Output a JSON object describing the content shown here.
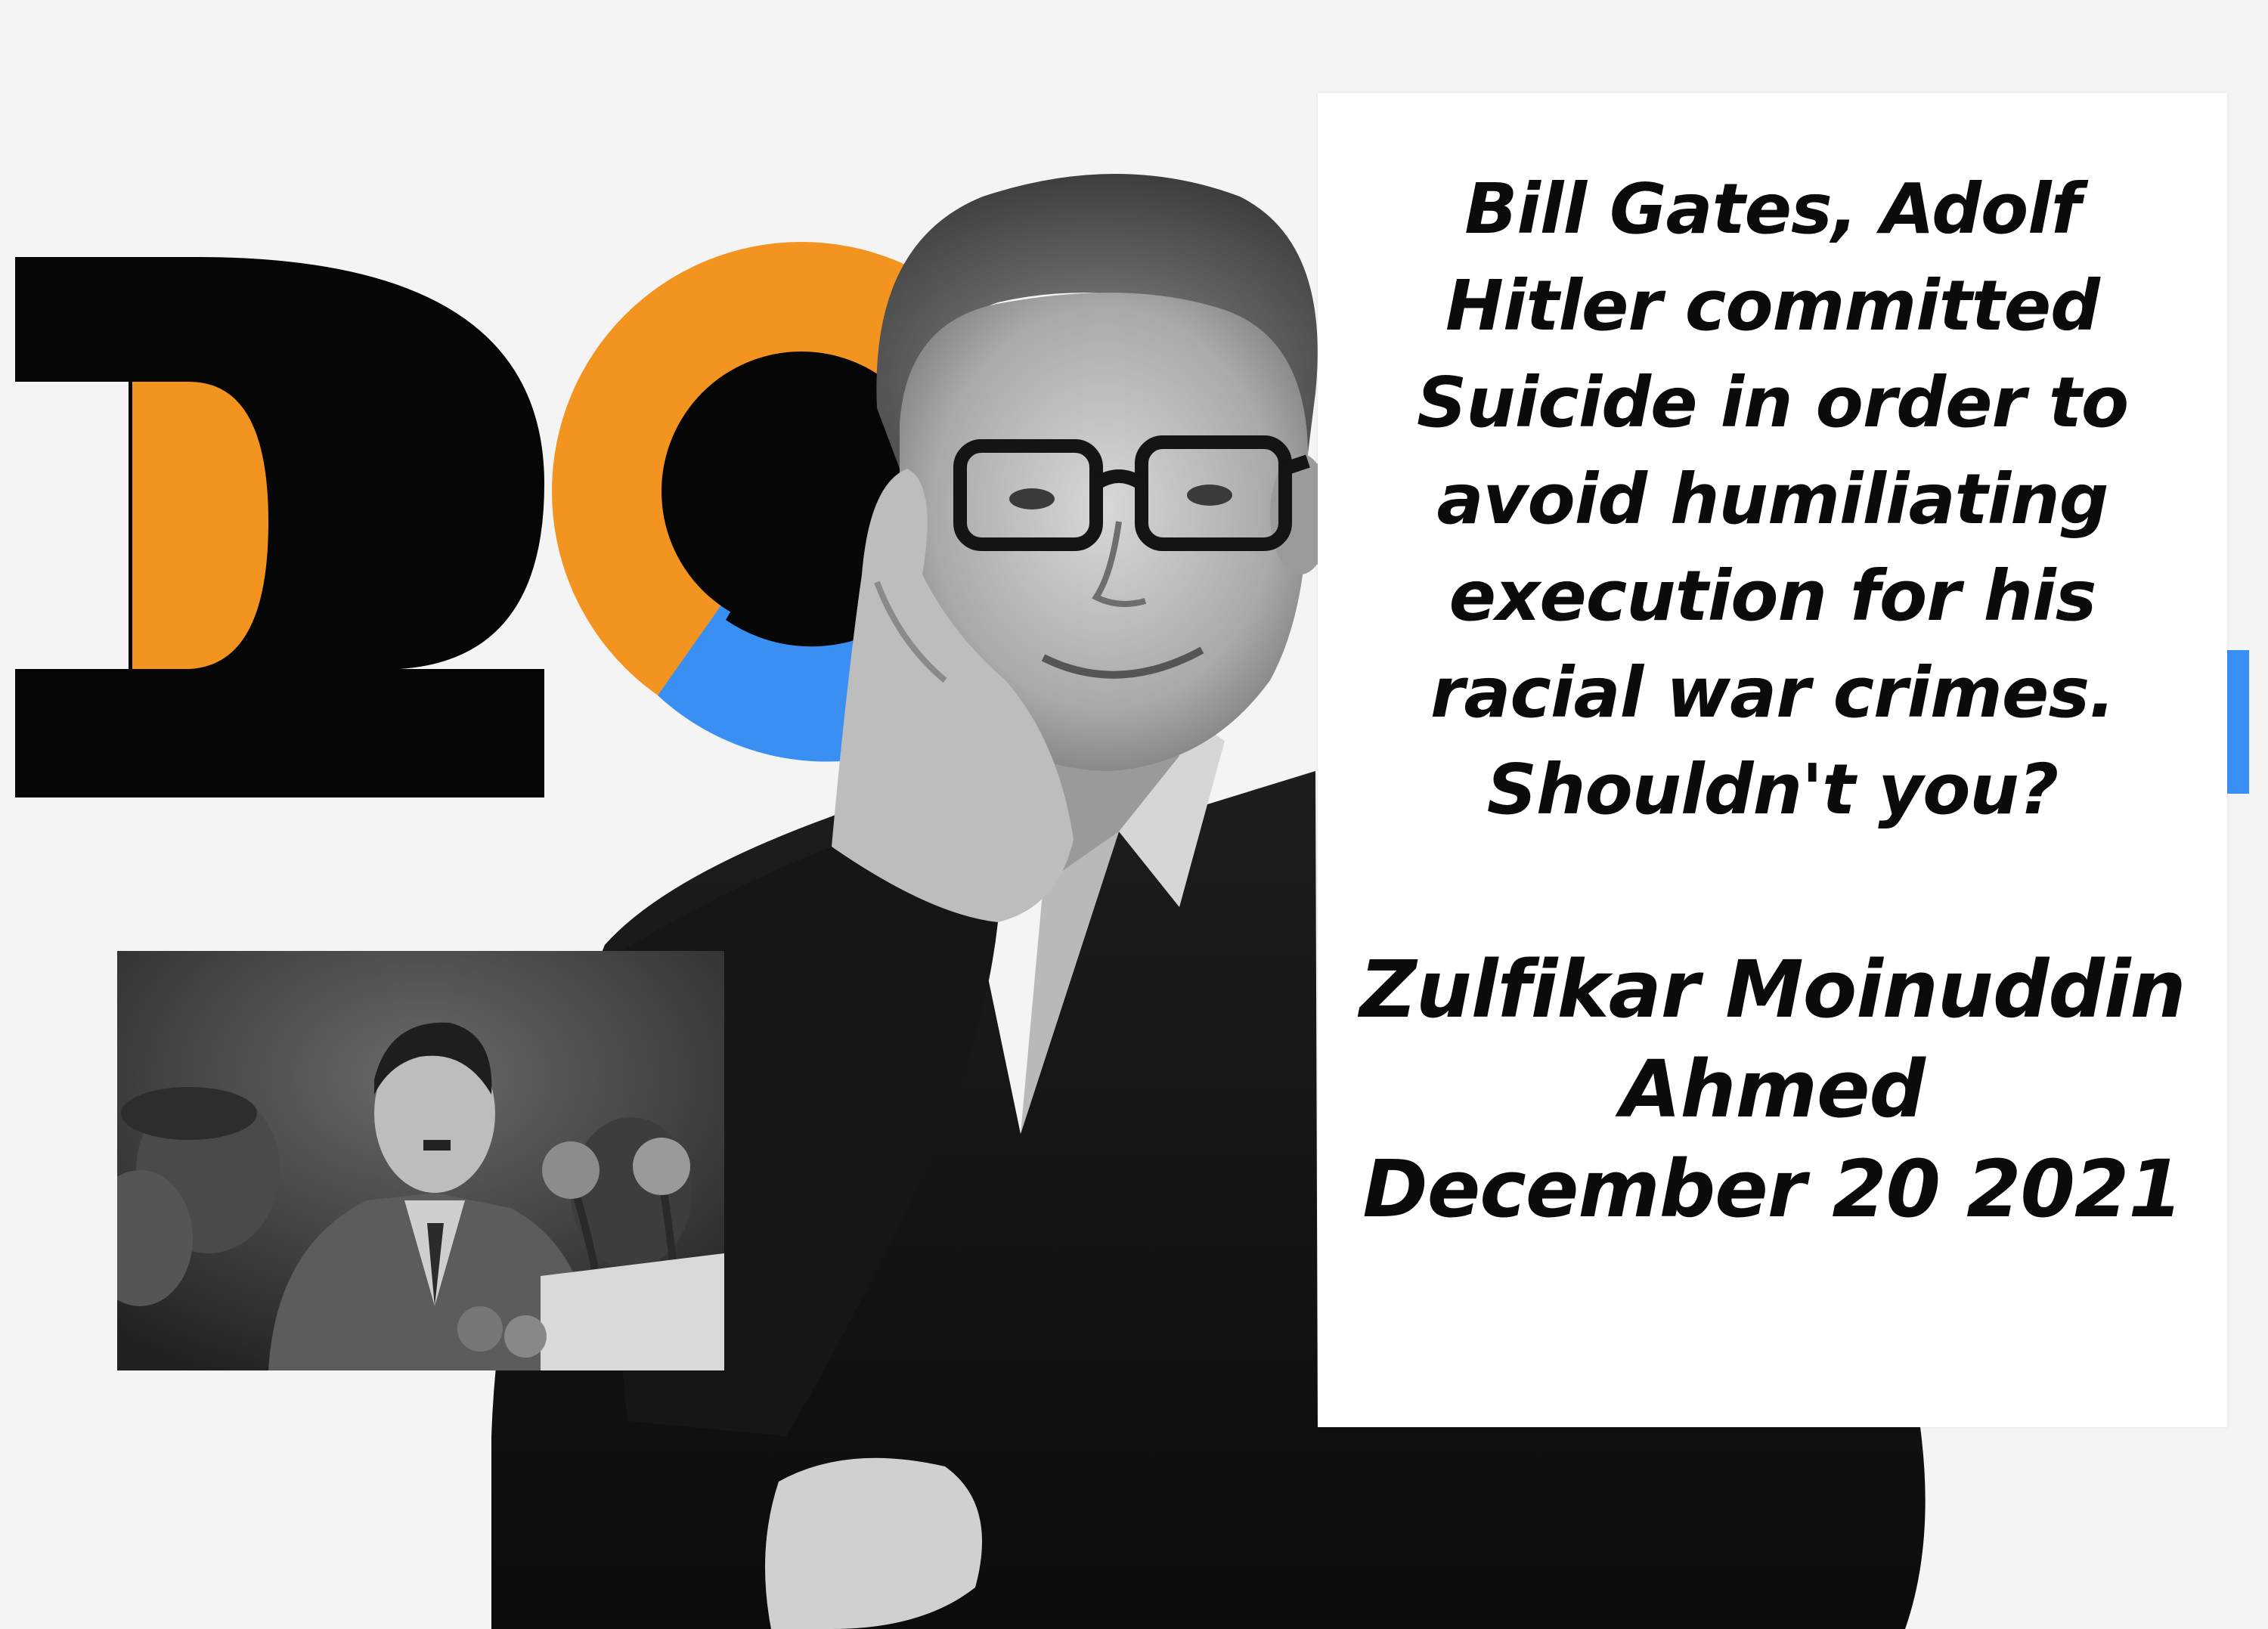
{
  "text_panel": {
    "message_lines": [
      "Bill Gates, Adolf",
      "Hitler committed",
      "Suicide in order to",
      "avoid humiliating",
      "execution for his",
      "racial war crimes.",
      "Shouldn't you?"
    ],
    "author_lines": [
      "Zulfikar Moinuddin",
      "Ahmed"
    ],
    "date": "December 20 2021"
  },
  "colors": {
    "background": "#f4f4f4",
    "logo_black": "#060606",
    "logo_orange": "#f39420",
    "logo_blue": "#3a8ff2",
    "panel": "#ffffff",
    "text": "#0b0b0b"
  }
}
